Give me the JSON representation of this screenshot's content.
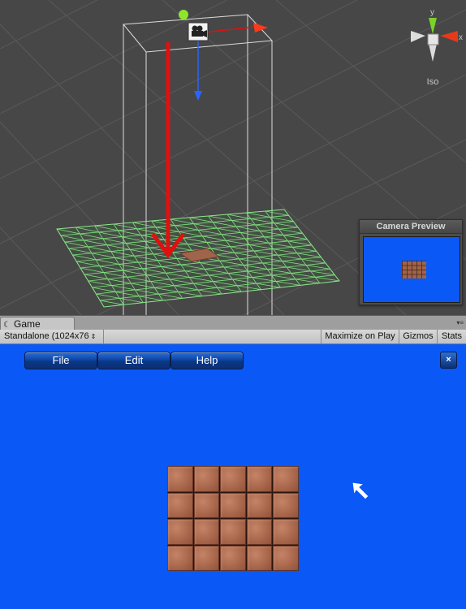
{
  "scene_view": {
    "gizmo": {
      "y_label": "y",
      "x_label": "x"
    },
    "projection_label": "Iso",
    "camera_preview": {
      "title": "Camera Preview"
    }
  },
  "game_panel": {
    "tab": {
      "label": "Game",
      "icon": "game-controller-icon"
    },
    "toolbar": {
      "resolution": "Standalone (1024x76",
      "resolution_arrows": "⇕",
      "maximize_label": "Maximize on Play",
      "gizmos_label": "Gizmos",
      "stats_label": "Stats"
    }
  },
  "game_view": {
    "menu": [
      {
        "label": "File"
      },
      {
        "label": "Edit"
      },
      {
        "label": "Help"
      }
    ],
    "close_label": "×",
    "tile_grid": {
      "columns": 5,
      "rows": 4
    }
  },
  "colors": {
    "game_background": "#0a58f5",
    "grid_wire": "#7fe07f",
    "arrow_red": "#e01010",
    "axis_blue": "#2a64ff"
  }
}
